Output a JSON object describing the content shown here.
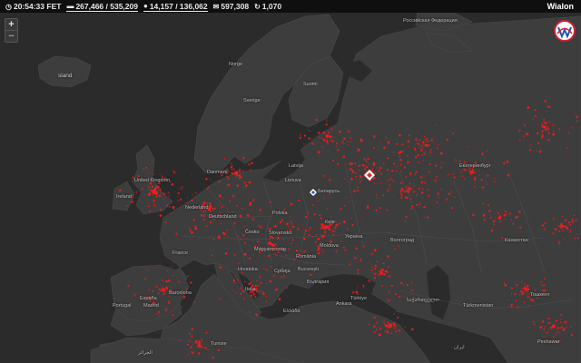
{
  "topbar": {
    "time": "20:54:33 FET",
    "units": "267,466 / 535,209",
    "users": "14,157 / 136,062",
    "messages": "597,308",
    "sessions": "1,070",
    "brand": "Wialon"
  },
  "icons": {
    "time": "clock-icon",
    "units": "car-icon",
    "users": "user-icon",
    "messages": "envelope-icon",
    "sessions": "refresh-icon"
  },
  "colors": {
    "ocean": "#2b2b2b",
    "land": "#3d3d3d",
    "points": "#ff1a1a",
    "bar": "#0f0f0f"
  },
  "zoom": {
    "in": "+",
    "out": "−"
  },
  "labels": {
    "iceland": "sland",
    "norge": "Norge",
    "sverige": "Sverige",
    "suomi": "Suomi",
    "danmark": "Danmark",
    "uk": "United Kingdom",
    "ireland": "Ireland",
    "nederland": "Nederland",
    "deutschland": "Deutschland",
    "polska": "Polska",
    "cesko": "Česko",
    "france": "France",
    "espana": "España",
    "portugal": "Portugal",
    "italia": "Italia",
    "hrvatska": "Hrvatska",
    "srbija": "Србија",
    "romania": "România",
    "bucuresti": "București",
    "latvija": "Latvija",
    "lietuva": "Lietuva",
    "belarus": "Беларусь",
    "kyiv": "Київ",
    "ukraine": "Україна",
    "volgograd": "Волгоград",
    "russia": "Российская Федерация",
    "ekb": "Екатеринбург",
    "kz": "Казахстан",
    "turkiye": "Türkiye",
    "ankara": "Ankara",
    "barcelona": "Barcelona",
    "madrid": "Madrid",
    "tunisie": "Tunisie",
    "algerie": "الجزائر",
    "tashkent": "Тошкент",
    "turkmenistan": "Türkmenistan",
    "peshawar": "Peshawar",
    "iran": "ایران",
    "slovensko": "Slovensko",
    "magyarorszag": "Magyarország",
    "moldova": "Moldova",
    "balgariya": "България",
    "ellada": "Ελλάδα",
    "gruziya": "საქართველო"
  }
}
